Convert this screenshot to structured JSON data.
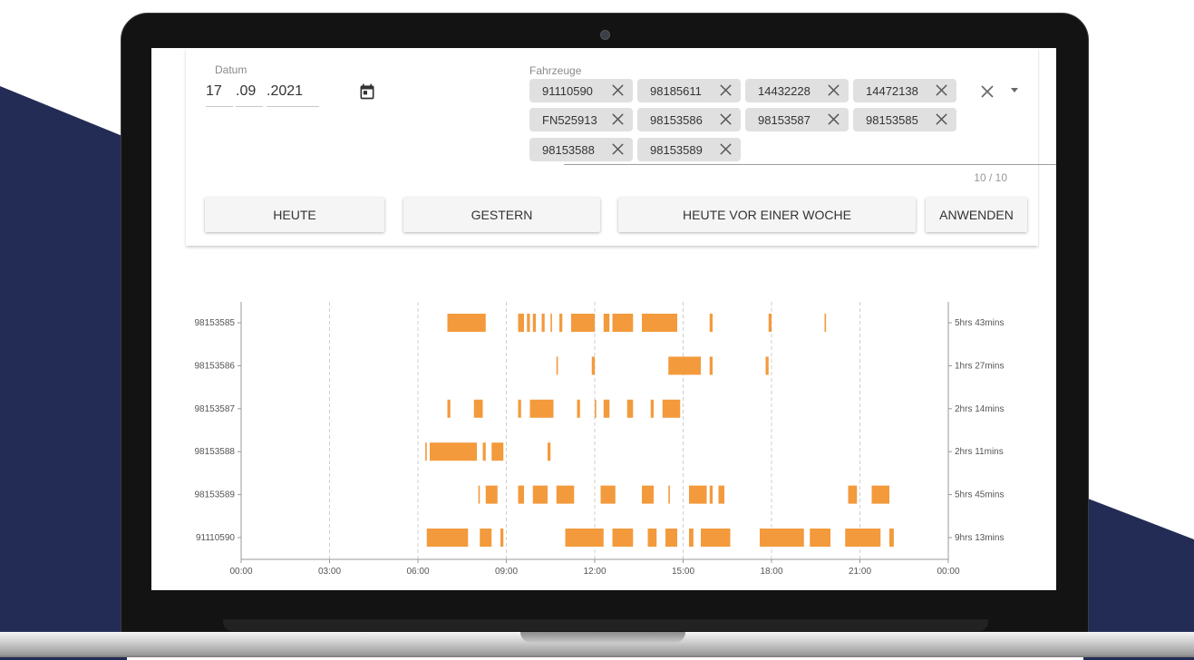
{
  "filter": {
    "date_label": "Datum",
    "date_day": "17",
    "date_month": ".09",
    "date_year": ".2021",
    "vehicles_label": "Fahrzeuge",
    "counter": "10 / 10",
    "chips": [
      "91110590",
      "98185611",
      "14432228",
      "14472138",
      "FN525913",
      "98153586",
      "98153587",
      "98153585",
      "98153588",
      "98153589"
    ]
  },
  "buttons": {
    "today": "HEUTE",
    "yesterday": "GESTERN",
    "week_ago": "HEUTE VOR EINER WOCHE",
    "apply": "ANWENDEN"
  },
  "chart_data": {
    "type": "timeline",
    "x_ticks": [
      "00:00",
      "03:00",
      "06:00",
      "09:00",
      "12:00",
      "15:00",
      "18:00",
      "21:00",
      "00:00"
    ],
    "x_range_hours": [
      0,
      24
    ],
    "bar_color": "#f39a3c",
    "rows": [
      {
        "vehicle": "98153585",
        "total": "5hrs 43mins",
        "segments": [
          [
            7.0,
            8.3
          ],
          [
            9.4,
            9.6
          ],
          [
            9.7,
            9.8
          ],
          [
            9.9,
            10.0
          ],
          [
            10.2,
            10.3
          ],
          [
            10.5,
            10.55
          ],
          [
            10.8,
            10.9
          ],
          [
            11.2,
            12.0
          ],
          [
            12.3,
            12.5
          ],
          [
            12.6,
            13.3
          ],
          [
            13.6,
            14.8
          ],
          [
            15.9,
            16.0
          ],
          [
            17.9,
            18.0
          ],
          [
            19.8,
            19.85
          ]
        ]
      },
      {
        "vehicle": "98153586",
        "total": "1hrs 27mins",
        "segments": [
          [
            10.7,
            10.75
          ],
          [
            11.9,
            12.0
          ],
          [
            14.5,
            15.6
          ],
          [
            15.9,
            16.0
          ],
          [
            17.8,
            17.9
          ]
        ]
      },
      {
        "vehicle": "98153587",
        "total": "2hrs 14mins",
        "segments": [
          [
            7.0,
            7.1
          ],
          [
            7.9,
            8.2
          ],
          [
            9.4,
            9.5
          ],
          [
            9.8,
            10.6
          ],
          [
            11.4,
            11.5
          ],
          [
            12.0,
            12.05
          ],
          [
            12.3,
            12.5
          ],
          [
            13.1,
            13.3
          ],
          [
            13.9,
            14.0
          ],
          [
            14.3,
            14.9
          ]
        ]
      },
      {
        "vehicle": "98153588",
        "total": "2hrs 11mins",
        "segments": [
          [
            6.25,
            6.3
          ],
          [
            6.4,
            8.0
          ],
          [
            8.2,
            8.3
          ],
          [
            8.5,
            8.9
          ],
          [
            10.4,
            10.5
          ]
        ]
      },
      {
        "vehicle": "98153589",
        "total": "5hrs 45mins",
        "segments": [
          [
            8.05,
            8.1
          ],
          [
            8.3,
            8.7
          ],
          [
            9.4,
            9.6
          ],
          [
            9.9,
            10.4
          ],
          [
            10.7,
            11.3
          ],
          [
            12.2,
            12.7
          ],
          [
            13.6,
            14.0
          ],
          [
            14.5,
            14.55
          ],
          [
            15.2,
            15.8
          ],
          [
            15.9,
            16.0
          ],
          [
            16.2,
            16.4
          ],
          [
            20.6,
            20.9
          ],
          [
            21.4,
            22.0
          ]
        ]
      },
      {
        "vehicle": "91110590",
        "total": "9hrs 13mins",
        "segments": [
          [
            6.3,
            7.7
          ],
          [
            8.1,
            8.5
          ],
          [
            8.8,
            8.9
          ],
          [
            11.0,
            12.3
          ],
          [
            12.6,
            13.3
          ],
          [
            13.8,
            14.1
          ],
          [
            14.4,
            14.8
          ],
          [
            15.2,
            15.35
          ],
          [
            15.6,
            16.6
          ],
          [
            17.6,
            19.1
          ],
          [
            19.3,
            20.0
          ],
          [
            20.5,
            21.7
          ],
          [
            22.0,
            22.15
          ]
        ]
      }
    ]
  }
}
